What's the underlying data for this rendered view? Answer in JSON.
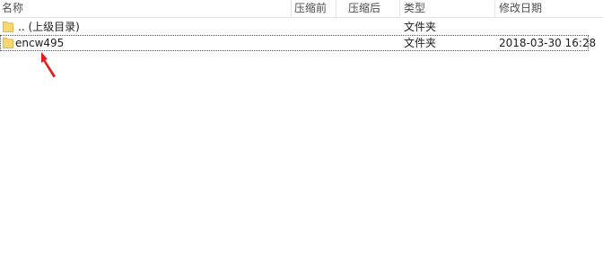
{
  "columns": {
    "name": "名称",
    "before": "压缩前",
    "after": "压缩后",
    "type": "类型",
    "modified": "修改日期"
  },
  "rows": [
    {
      "name": ".. (上级目录)",
      "type": "文件夹",
      "modified": "",
      "icon": "folder-icon",
      "selected": false
    },
    {
      "name": "encw495",
      "type": "文件夹",
      "modified": "2018-03-30 16:28",
      "icon": "folder-icon",
      "selected": true
    }
  ],
  "colors": {
    "folder": "#f7d774",
    "folder_dark": "#e4b84a",
    "annotation_arrow": "#e02020"
  }
}
